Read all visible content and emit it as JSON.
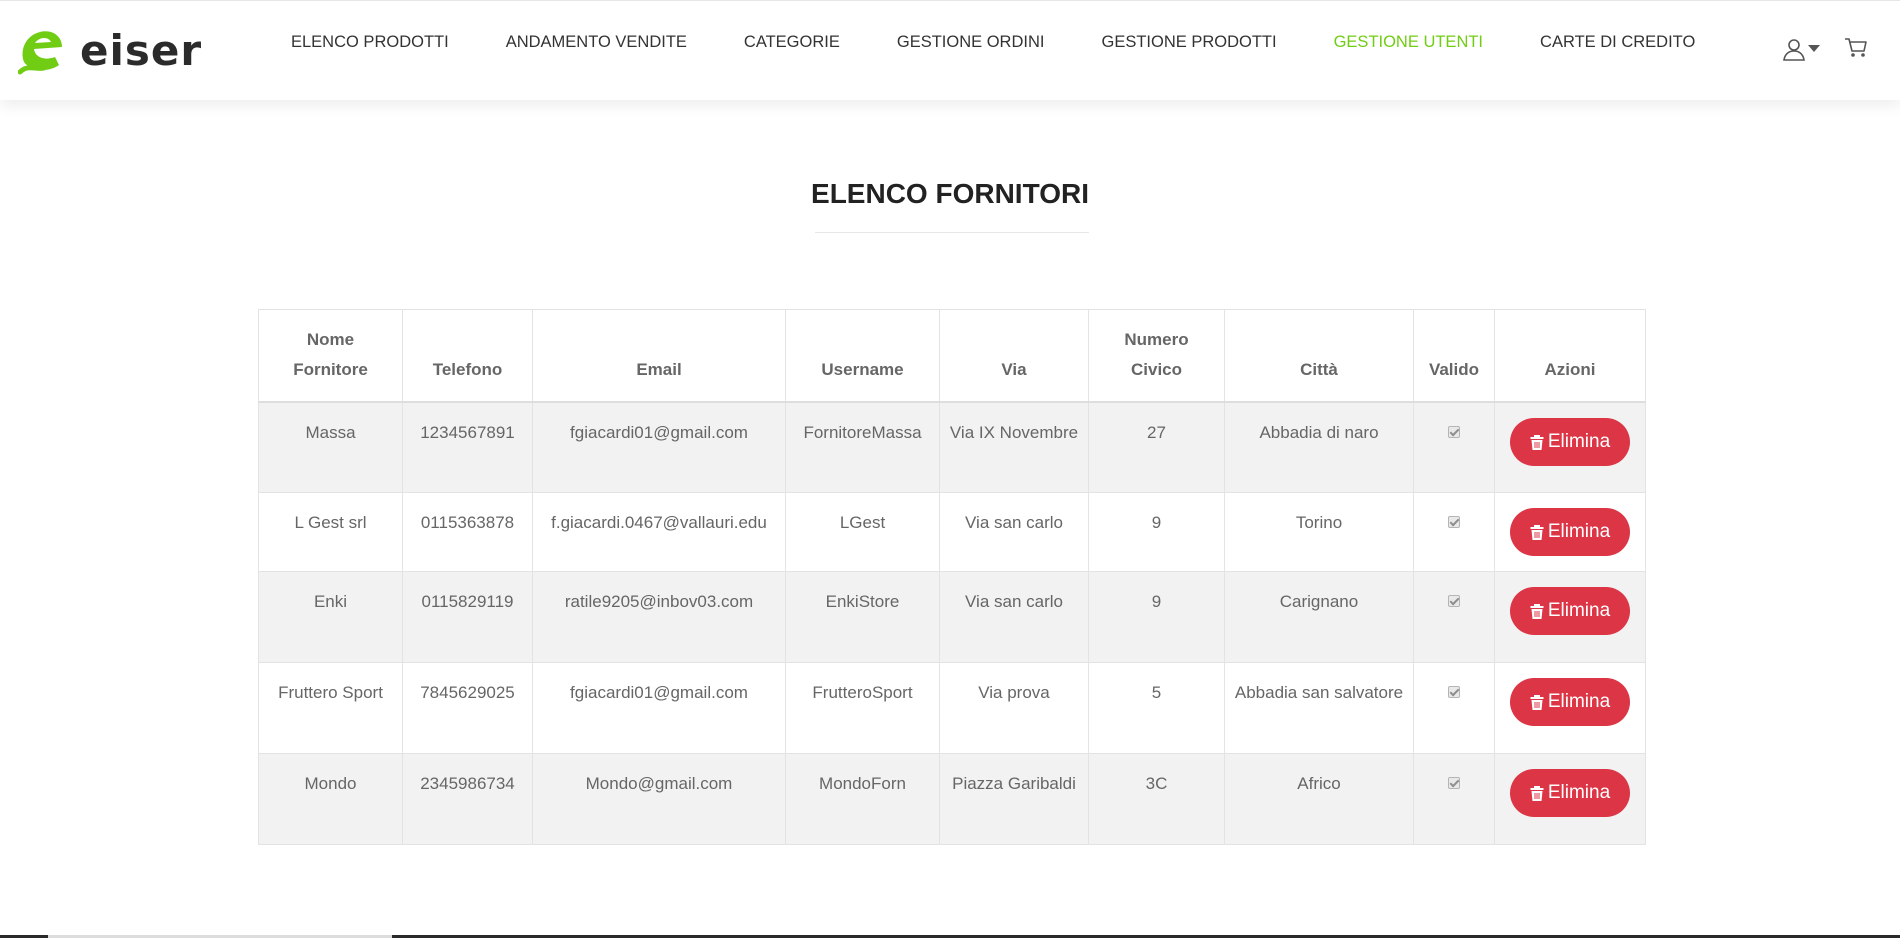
{
  "brand": {
    "name": "eiser",
    "accent": "#71cd14"
  },
  "nav": {
    "items": [
      {
        "label": "ELENCO PRODOTTI"
      },
      {
        "label": "ANDAMENTO VENDITE"
      },
      {
        "label": "CATEGORIE"
      },
      {
        "label": "GESTIONE ORDINI"
      },
      {
        "label": "GESTIONE PRODOTTI"
      },
      {
        "label": "GESTIONE UTENTI",
        "active": true
      },
      {
        "label": "CARTE DI CREDITO"
      }
    ]
  },
  "header_icons": {
    "user": "user-icon",
    "dropdown": "caret-down-icon",
    "cart": "cart-icon"
  },
  "page": {
    "title": "ELENCO FORNITORI"
  },
  "table": {
    "columns": [
      {
        "line1": "Nome",
        "line2": "Fornitore"
      },
      {
        "line1": "",
        "line2": "Telefono"
      },
      {
        "line1": "",
        "line2": "Email"
      },
      {
        "line1": "",
        "line2": "Username"
      },
      {
        "line1": "",
        "line2": "Via"
      },
      {
        "line1": "Numero",
        "line2": "Civico"
      },
      {
        "line1": "",
        "line2": "Città"
      },
      {
        "line1": "",
        "line2": "Valido"
      },
      {
        "line1": "",
        "line2": "Azioni"
      }
    ],
    "rows": [
      {
        "nome": "Massa",
        "telefono": "1234567891",
        "email": "fgiacardi01@gmail.com",
        "username": "FornitoreMassa",
        "via": "Via IX Novembre",
        "civico": "27",
        "citta": "Abbadia di naro",
        "valido": true
      },
      {
        "nome": "L Gest srl",
        "telefono": "0115363878",
        "email": "f.giacardi.0467@vallauri.edu",
        "username": "LGest",
        "via": "Via san carlo",
        "civico": "9",
        "citta": "Torino",
        "valido": true
      },
      {
        "nome": "Enki",
        "telefono": "0115829119",
        "email": "ratile9205@inbov03.com",
        "username": "EnkiStore",
        "via": "Via san carlo",
        "civico": "9",
        "citta": "Carignano",
        "valido": true
      },
      {
        "nome": "Fruttero Sport",
        "telefono": "7845629025",
        "email": "fgiacardi01@gmail.com",
        "username": "FrutteroSport",
        "via": "Via prova",
        "civico": "5",
        "citta": "Abbadia san salvatore",
        "valido": true
      },
      {
        "nome": "Mondo",
        "telefono": "2345986734",
        "email": "Mondo@gmail.com",
        "username": "MondoForn",
        "via": "Piazza Garibaldi",
        "civico": "3C",
        "citta": "Africo",
        "valido": true
      }
    ],
    "action_label": "Elimina",
    "action_icon": "trash-icon",
    "action_color": "#dc3545"
  }
}
